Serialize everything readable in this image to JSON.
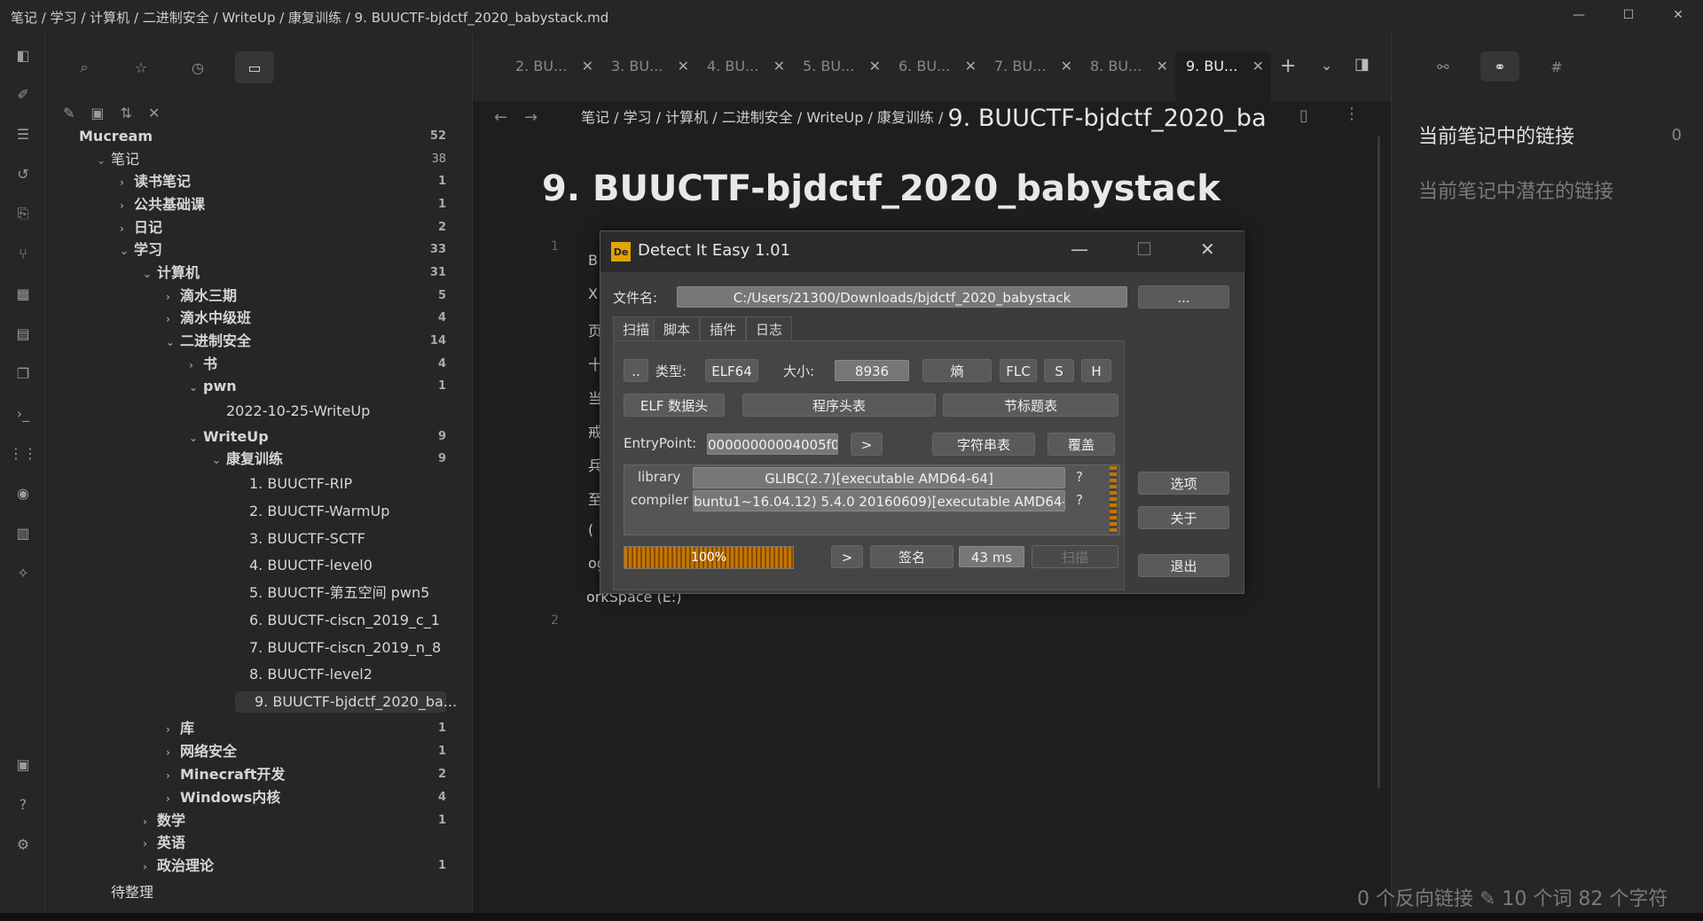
{
  "window": {
    "breadcrumb": "笔记 /  学习 /  计算机 /  二进制安全 /  WriteUp /  康复训练 /  9. BUUCTF-bjdctf_2020_babystack.md",
    "minimize": "—",
    "maximize": "☐",
    "close": "✕"
  },
  "ribbon": [
    "sidebar-toggle-icon",
    "pen-icon",
    "list-icon",
    "undo-icon",
    "file-export-icon",
    "graph-icon",
    "grid-icon",
    "calendar-icon",
    "copy-icon",
    "terminal-icon",
    "columns-icon",
    "microphone-icon",
    "table-icon",
    "lightbulb-icon",
    "vault-icon",
    "help-icon",
    "settings-icon"
  ],
  "sidebar": {
    "tabs": [
      "search-icon",
      "star-icon",
      "clock-icon",
      "folder-icon"
    ],
    "actions": [
      "new-note-icon",
      "new-folder-icon",
      "sort-icon",
      "collapse-icon"
    ],
    "tree": [
      {
        "label": "Mucream",
        "count": "52",
        "indent": 0,
        "chev": "",
        "bold": true
      },
      {
        "label": "笔记",
        "count": "38",
        "indent": 1,
        "chev": "⌄"
      },
      {
        "label": "读书笔记",
        "count": "1",
        "indent": 2,
        "chev": "›"
      },
      {
        "label": "公共基础课",
        "count": "1",
        "indent": 2,
        "chev": "›"
      },
      {
        "label": "日记",
        "count": "2",
        "indent": 2,
        "chev": "›"
      },
      {
        "label": "学习",
        "count": "33",
        "indent": 2,
        "chev": "⌄"
      },
      {
        "label": "计算机",
        "count": "31",
        "indent": 3,
        "chev": "⌄"
      },
      {
        "label": "滴水三期",
        "count": "5",
        "indent": 4,
        "chev": "›"
      },
      {
        "label": "滴水中级班",
        "count": "4",
        "indent": 4,
        "chev": "›"
      },
      {
        "label": "二进制安全",
        "count": "14",
        "indent": 4,
        "chev": "⌄"
      },
      {
        "label": "书",
        "count": "4",
        "indent": 5,
        "chev": "›"
      },
      {
        "label": "pwn",
        "count": "1",
        "indent": 5,
        "chev": "⌄"
      },
      {
        "label": "2022-10-25-WriteUp",
        "count": "",
        "indent": 6,
        "chev": "",
        "file": true
      },
      {
        "label": "WriteUp",
        "count": "9",
        "indent": 5,
        "chev": "⌄"
      },
      {
        "label": "康复训练",
        "count": "9",
        "indent": 6,
        "chev": "⌄"
      },
      {
        "label": "1. BUUCTF-RIP",
        "count": "",
        "indent": 7,
        "chev": "",
        "file": true
      },
      {
        "label": "2. BUUCTF-WarmUp",
        "count": "",
        "indent": 7,
        "chev": "",
        "file": true
      },
      {
        "label": "3. BUUCTF-SCTF",
        "count": "",
        "indent": 7,
        "chev": "",
        "file": true
      },
      {
        "label": "4. BUUCTF-level0",
        "count": "",
        "indent": 7,
        "chev": "",
        "file": true
      },
      {
        "label": "5. BUUCTF-第五空间 pwn5",
        "count": "",
        "indent": 7,
        "chev": "",
        "file": true
      },
      {
        "label": "6. BUUCTF-ciscn_2019_c_1",
        "count": "",
        "indent": 7,
        "chev": "",
        "file": true
      },
      {
        "label": "7. BUUCTF-ciscn_2019_n_8",
        "count": "",
        "indent": 7,
        "chev": "",
        "file": true
      },
      {
        "label": "8. BUUCTF-level2",
        "count": "",
        "indent": 7,
        "chev": "",
        "file": true
      },
      {
        "label": "9. BUUCTF-bjdctf_2020_ba...",
        "count": "",
        "indent": 7,
        "chev": "",
        "file": true,
        "selected": true
      },
      {
        "label": "库",
        "count": "1",
        "indent": 4,
        "chev": "›"
      },
      {
        "label": "网络安全",
        "count": "1",
        "indent": 4,
        "chev": "›"
      },
      {
        "label": "Minecraft开发",
        "count": "2",
        "indent": 4,
        "chev": "›"
      },
      {
        "label": "Windows内核",
        "count": "4",
        "indent": 4,
        "chev": "›"
      },
      {
        "label": "数学",
        "count": "1",
        "indent": 3,
        "chev": "›"
      },
      {
        "label": "英语",
        "count": "",
        "indent": 3,
        "chev": "›"
      },
      {
        "label": "政治理论",
        "count": "1",
        "indent": 3,
        "chev": "›"
      },
      {
        "label": "待整理",
        "count": "",
        "indent": 1,
        "chev": "",
        "file": true
      }
    ]
  },
  "tabs": [
    "2. BU...",
    "3. BU...",
    "4. BU...",
    "5. BU...",
    "6. BU...",
    "7. BU...",
    "8. BU...",
    "9. BU..."
  ],
  "tab_active_index": 7,
  "nav": {
    "crumbs": "笔记  /  学习  /  计算机  /  二进制安全  /  WriteUp  /  康复训练  /",
    "current": "9. BUUCTF-bjdctf_2020_ba"
  },
  "editor": {
    "title": "9. BUUCTF-bjdctf_2020_babystack",
    "line1": "1",
    "line2": "2",
    "fragments": [
      "B",
      "X",
      "页",
      "十",
      "当",
      "戒",
      "兵",
      "至",
      "(",
      "og",
      "orkSpace (E:)"
    ]
  },
  "right": {
    "h1": "当前笔记中的链接",
    "count": "0",
    "h2": "当前笔记中潜在的链接",
    "status": "0 个反向链接  ✎ 10 个词  82 个字符"
  },
  "die": {
    "title": "Detect It Easy 1.01",
    "logo": "De",
    "file_label": "文件名:",
    "file_path": "C:/Users/21300/Downloads/bjdctf_2020_babystack",
    "browse": "...",
    "tabs": [
      "扫描",
      "脚本",
      "插件",
      "日志"
    ],
    "dots": "..",
    "type_label": "类型:",
    "type_value": "ELF64",
    "size_label": "大小:",
    "size_value": "8936",
    "entropy": "熵",
    "flc": "FLC",
    "s": "S",
    "h": "H",
    "elf_header": "ELF 数据头",
    "program_header": "程序头表",
    "section_header": "节标题表",
    "entry_label": "EntryPoint:",
    "entry_value": "00000000004005f0",
    "entry_go": ">",
    "strings": "字符串表",
    "overlay": "覆盖",
    "lib_label": "library",
    "lib_value": "GLIBC(2.7)[executable AMD64-64]",
    "comp_label": "compiler",
    "comp_value": "buntu1~16.04.12) 5.4.0 20160609)[executable AMD64-64]",
    "q": "?",
    "progress": "100%",
    "prog_go": ">",
    "signatures": "签名",
    "time": "43 ms",
    "scan": "扫描",
    "options": "选项",
    "about": "关于",
    "exit": "退出"
  }
}
